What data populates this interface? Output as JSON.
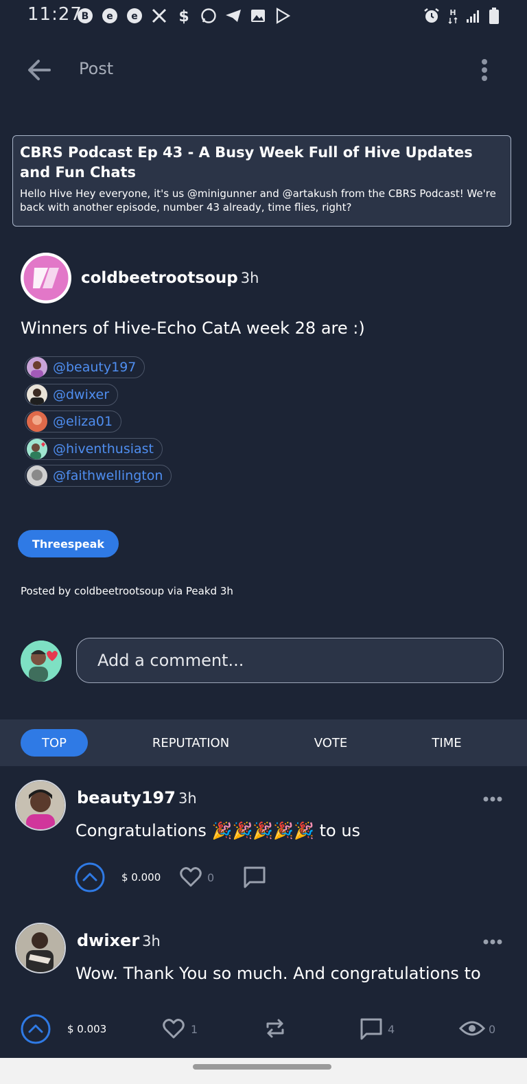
{
  "status": {
    "time": "11:27",
    "left_icons": [
      "bitcoin-icon",
      "e-icon",
      "e-alt-icon",
      "x-icon",
      "dollar-icon",
      "whatsapp-icon",
      "telegram-icon",
      "gallery-icon",
      "play-store-icon"
    ],
    "right_icons": [
      "alarm-icon",
      "network-h-icon",
      "signal-icon",
      "battery-icon"
    ]
  },
  "appbar": {
    "title": "Post"
  },
  "parent": {
    "title": "CBRS Podcast Ep 43 - A Busy Week Full of Hive Updates and Fun Chats",
    "excerpt": "Hello Hive Hey everyone, it's us @minigunner and @artakush from the CBRS Podcast! We're back with another episode, number 43 already, time flies, right?"
  },
  "post": {
    "author": "coldbeetrootsoup",
    "time": "3h",
    "body": "Winners of Hive-Echo CatA week 28 are :)",
    "mentions": [
      "@beauty197",
      "@dwixer",
      "@eliza01",
      "@hiventhusiast",
      "@faithwellington"
    ],
    "tag": "Threespeak",
    "posted_by": "Posted by coldbeetrootsoup via Peakd 3h"
  },
  "comment_box": {
    "placeholder": "Add a comment..."
  },
  "sort": {
    "tabs": [
      "TOP",
      "REPUTATION",
      "VOTE",
      "TIME"
    ],
    "active": "TOP"
  },
  "comments": [
    {
      "author": "beauty197",
      "time": "3h",
      "text": "Congratulations 🎉🎉🎉🎉🎉 to us",
      "payout": "$ 0.000",
      "likes": "0"
    },
    {
      "author": "dwixer",
      "time": "3h",
      "text": "Wow. Thank You so much. And congratulations to"
    }
  ],
  "bottom": {
    "payout": "$ 0.003",
    "likes": "1",
    "comments": "4",
    "views": "0"
  },
  "colors": {
    "background": "#1c2435",
    "card": "#2b3447",
    "accent": "#2f7ae5",
    "link": "#4f8ef0"
  }
}
